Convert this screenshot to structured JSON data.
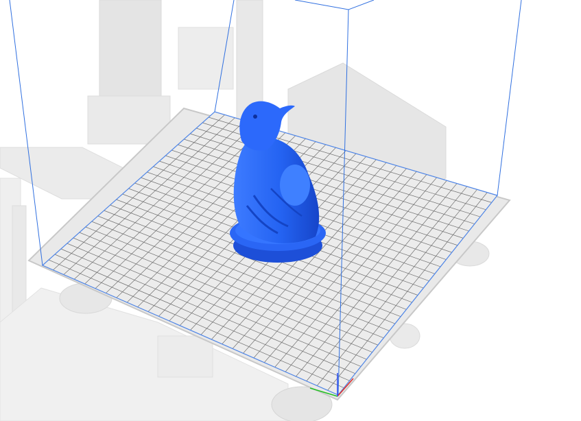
{
  "app": {
    "view": "3d-print-preparation-viewport"
  },
  "scene": {
    "background_color": "#ffffff",
    "printer_frame_color": "#d8d8d8",
    "build_plate_color": "#e6e6e6",
    "grid_line_color": "#6e6e6e",
    "plate_border_color": "#4f86e8",
    "build_volume_color": "#2f6fe0",
    "model_color": "#2463f2",
    "model_shadow_color": "#1645c9",
    "grid_cells": 28,
    "model_name_visible": false
  },
  "axis_gizmo": {
    "x_color": "#e0302c",
    "y_color": "#22c022",
    "z_color": "#2f4ff0"
  },
  "icons": [
    "axis-gizmo-icon"
  ]
}
